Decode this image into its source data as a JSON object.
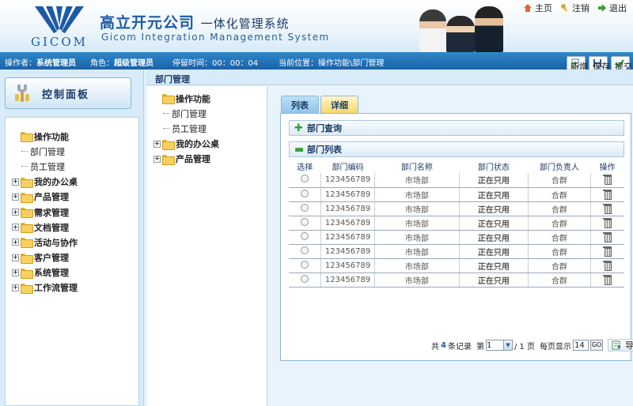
{
  "header": {
    "logo_text": "GICOM",
    "title_cn": "高立开元公司",
    "title_sub": "一体化管理系统",
    "title_en": "Gicom Integration Management System",
    "top_links": [
      {
        "label": "主页",
        "icon": "home-icon"
      },
      {
        "label": "注销",
        "icon": "key-icon"
      },
      {
        "label": "退出",
        "icon": "exit-arrow-icon"
      }
    ]
  },
  "statusbar": {
    "operator_label": "操作者：",
    "operator_value": "系统管理员",
    "role_label": "角色：",
    "role_value": "超级管理员",
    "stay_label": "停留时间：",
    "stay_value": "00：00：04",
    "location_label": "当前位置：",
    "location_value": "操作功能\\部门管理",
    "buttons": {
      "add": "新增",
      "save": "保存",
      "submit": "提交"
    }
  },
  "left": {
    "panel_title": "控制面板",
    "tree": [
      {
        "label": "操作功能",
        "level": 0,
        "bold": true,
        "expanded": true
      },
      {
        "label": "部门管理",
        "level": 1
      },
      {
        "label": "员工管理",
        "level": 1
      },
      {
        "label": "我的办公桌",
        "level": 0,
        "bold": true
      },
      {
        "label": "产品管理",
        "level": 0,
        "bold": true
      },
      {
        "label": "需求管理",
        "level": 0,
        "bold": true
      },
      {
        "label": "文档管理",
        "level": 0,
        "bold": true
      },
      {
        "label": "活动与协作",
        "level": 0,
        "bold": true
      },
      {
        "label": "客户管理",
        "level": 0,
        "bold": true
      },
      {
        "label": "系统管理",
        "level": 0,
        "bold": true
      },
      {
        "label": "工作流管理",
        "level": 0,
        "bold": true
      }
    ]
  },
  "breadcrumb": "部门管理",
  "middle": {
    "tree": [
      {
        "label": "操作功能",
        "level": 0,
        "bold": true,
        "expanded": true
      },
      {
        "label": "部门管理",
        "level": 1
      },
      {
        "label": "员工管理",
        "level": 1
      },
      {
        "label": "我的办公桌",
        "level": 0,
        "bold": true
      },
      {
        "label": "产品管理",
        "level": 0,
        "bold": true
      }
    ]
  },
  "main": {
    "tabs": [
      "列表",
      "详细"
    ],
    "query_title": "部门查询",
    "list_title": "部门列表",
    "columns": [
      "选择",
      "部门编码",
      "部门名称",
      "部门状态",
      "部门负责人",
      "操作"
    ],
    "rows": [
      {
        "code": "123456789",
        "name": "市场部",
        "status": "正在只用",
        "owner": "合群"
      },
      {
        "code": "123456789",
        "name": "市场部",
        "status": "正在只用",
        "owner": "合群"
      },
      {
        "code": "123456789",
        "name": "市场部",
        "status": "正在只用",
        "owner": "合群"
      },
      {
        "code": "123456789",
        "name": "市场部",
        "status": "正在只用",
        "owner": "合群"
      },
      {
        "code": "123456789",
        "name": "市场部",
        "status": "正在只用",
        "owner": "合群"
      },
      {
        "code": "123456789",
        "name": "市场部",
        "status": "正在只用",
        "owner": "合群"
      },
      {
        "code": "123456789",
        "name": "市场部",
        "status": "正在只用",
        "owner": "合群"
      },
      {
        "code": "123456789",
        "name": "市场部",
        "status": "正在只用",
        "owner": "合群"
      }
    ],
    "pager": {
      "total_prefix": "共",
      "total_count": "4",
      "total_suffix": "条记录",
      "page_prefix": "第",
      "page_value": "1",
      "page_total": "/ 1 页",
      "per_page_label": "每页显示",
      "per_page_value": "14",
      "go_label": "GO",
      "export_label": "导出"
    }
  }
}
